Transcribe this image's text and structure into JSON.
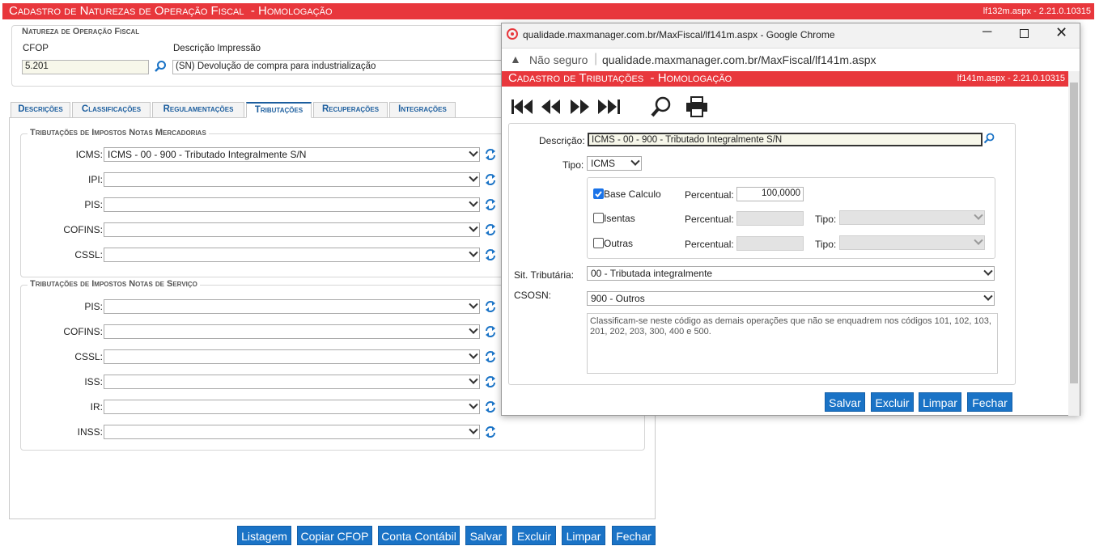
{
  "main": {
    "title": "Cadastro de Naturezas de Operação Fiscal  - Homologação",
    "version": "lf132m.aspx - 2.21.0.10315",
    "natureza_legend": "Natureza de Operação Fiscal",
    "cfop_label": "CFOP",
    "cfop_value": "5.201",
    "descricao_label": "Descrição Impressão",
    "descricao_value": "(SN) Devolução de compra para industrialização",
    "tabs": [
      "Descrições",
      "Classificações",
      "Regulamentações",
      "Tributações",
      "Recuperações",
      "Integrações"
    ],
    "active_tab": "Tributações",
    "merc_legend": "Tributações de Impostos Notas Mercadorias",
    "merc_rows": [
      {
        "label": "ICMS:",
        "value": "ICMS - 00 - 900 - Tributado Integralmente S/N"
      },
      {
        "label": "IPI:",
        "value": ""
      },
      {
        "label": "PIS:",
        "value": ""
      },
      {
        "label": "COFINS:",
        "value": ""
      },
      {
        "label": "CSSL:",
        "value": ""
      }
    ],
    "serv_legend": "Tributações de Impostos Notas de Serviço",
    "serv_rows": [
      {
        "label": "PIS:",
        "value": ""
      },
      {
        "label": "COFINS:",
        "value": ""
      },
      {
        "label": "CSSL:",
        "value": ""
      },
      {
        "label": "ISS:",
        "value": ""
      },
      {
        "label": "IR:",
        "value": ""
      },
      {
        "label": "INSS:",
        "value": ""
      }
    ],
    "buttons": [
      "Listagem",
      "Copiar CFOP",
      "Conta Contábil",
      "Salvar",
      "Excluir",
      "Limpar",
      "Fechar"
    ]
  },
  "popup": {
    "window_title": "qualidade.maxmanager.com.br/MaxFiscal/lf141m.aspx - Google Chrome",
    "not_secure": "Não seguro",
    "url": "qualidade.maxmanager.com.br/MaxFiscal/lf141m.aspx",
    "title": "Cadastro de Tributações  - Homologação",
    "version": "lf141m.aspx - 2.21.0.10315",
    "descricao_label": "Descrição:",
    "descricao_value": "ICMS - 00 - 900 - Tributado Integralmente S/N",
    "tipo_label": "Tipo:",
    "tipo_value": "ICMS",
    "base_calculo_label": "Base Calculo",
    "base_calculo_checked": true,
    "isentas_label": "Isentas",
    "outras_label": "Outras",
    "percentual_label": "Percentual:",
    "percentual_value": "100,0000",
    "tipo2_label": "Tipo:",
    "sit_label": "Sit. Tributária:",
    "sit_value": "00 - Tributada integralmente",
    "csosn_label": "CSOSN:",
    "csosn_value": "900 - Outros",
    "obs_text": "Classificam-se neste código as demais operações que não se enquadrem nos códigos 101, 102, 103, 201, 202, 203, 300, 400 e 500.",
    "buttons": [
      "Salvar",
      "Excluir",
      "Limpar",
      "Fechar"
    ]
  },
  "colors": {
    "header": "#e8373c",
    "button": "#1a73c6",
    "tab_text": "#1c5e9e"
  }
}
